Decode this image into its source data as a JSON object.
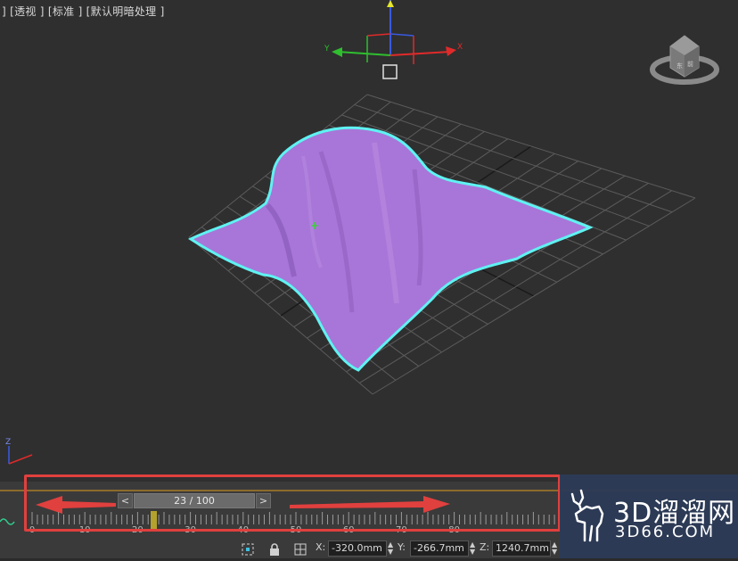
{
  "viewport": {
    "label": "] [透视 ] [标准 ] [默认明暗处理 ]"
  },
  "gizmo": {
    "axis_x": "X",
    "axis_y": "Y",
    "axis_z": "Z"
  },
  "timeline": {
    "prev_label": "<",
    "next_label": ">",
    "frame_display": "23 / 100",
    "current_frame": 23,
    "total_frames": 100,
    "tick_labels": [
      "0",
      "10",
      "20",
      "30",
      "40",
      "50",
      "60",
      "70",
      "80"
    ]
  },
  "status": {
    "x_label": "X:",
    "x_value": "-320.0mm",
    "y_label": "Y:",
    "y_value": "-266.7mm",
    "z_label": "Z:",
    "z_value": "1240.7mm"
  },
  "watermark": {
    "title": "3D溜溜网",
    "url": "3D66.COM"
  },
  "colors": {
    "cloth": "#a876d8",
    "selection": "#5ff2f2",
    "highlight": "#e0403e",
    "frame_marker": "#b4a22c"
  }
}
